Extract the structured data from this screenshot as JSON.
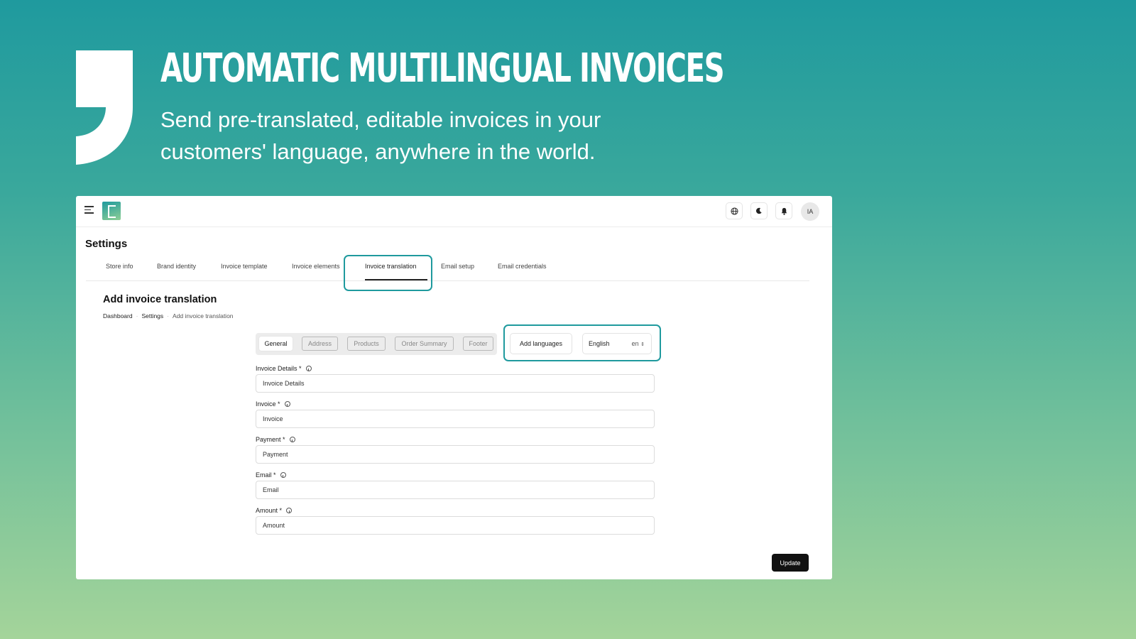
{
  "hero": {
    "title": "AUTOMATIC MULTILINGUAL INVOICES",
    "subtitle": "Send pre-translated, editable invoices in your customers' language, anywhere in the world."
  },
  "topbar": {
    "icons": [
      "menu-icon",
      "app-logo",
      "globe-icon",
      "moon-icon",
      "bell-icon"
    ],
    "avatar_initials": "IA"
  },
  "settings": {
    "title": "Settings",
    "tabs": [
      {
        "label": "Store info"
      },
      {
        "label": "Brand identity"
      },
      {
        "label": "Invoice template"
      },
      {
        "label": "Invoice elements"
      },
      {
        "label": "Invoice translation",
        "active": true
      },
      {
        "label": "Email setup"
      },
      {
        "label": "Email credentials"
      }
    ]
  },
  "section": {
    "title": "Add invoice translation",
    "breadcrumb": [
      "Dashboard",
      "Settings",
      "Add invoice translation"
    ]
  },
  "subtabs": [
    {
      "label": "General",
      "active": true
    },
    {
      "label": "Address"
    },
    {
      "label": "Products"
    },
    {
      "label": "Order Summary"
    },
    {
      "label": "Footer"
    }
  ],
  "language": {
    "add_button": "Add languages",
    "selected_name": "English",
    "selected_code": "en"
  },
  "fields": [
    {
      "label": "Invoice Details *",
      "value": "Invoice Details"
    },
    {
      "label": "Invoice *",
      "value": "Invoice"
    },
    {
      "label": "Payment *",
      "value": "Payment"
    },
    {
      "label": "Email *",
      "value": "Email"
    },
    {
      "label": "Amount *",
      "value": "Amount"
    }
  ],
  "actions": {
    "update_label": "Update"
  },
  "colors": {
    "accent": "#1f9a9e",
    "primary_button": "#111111"
  }
}
